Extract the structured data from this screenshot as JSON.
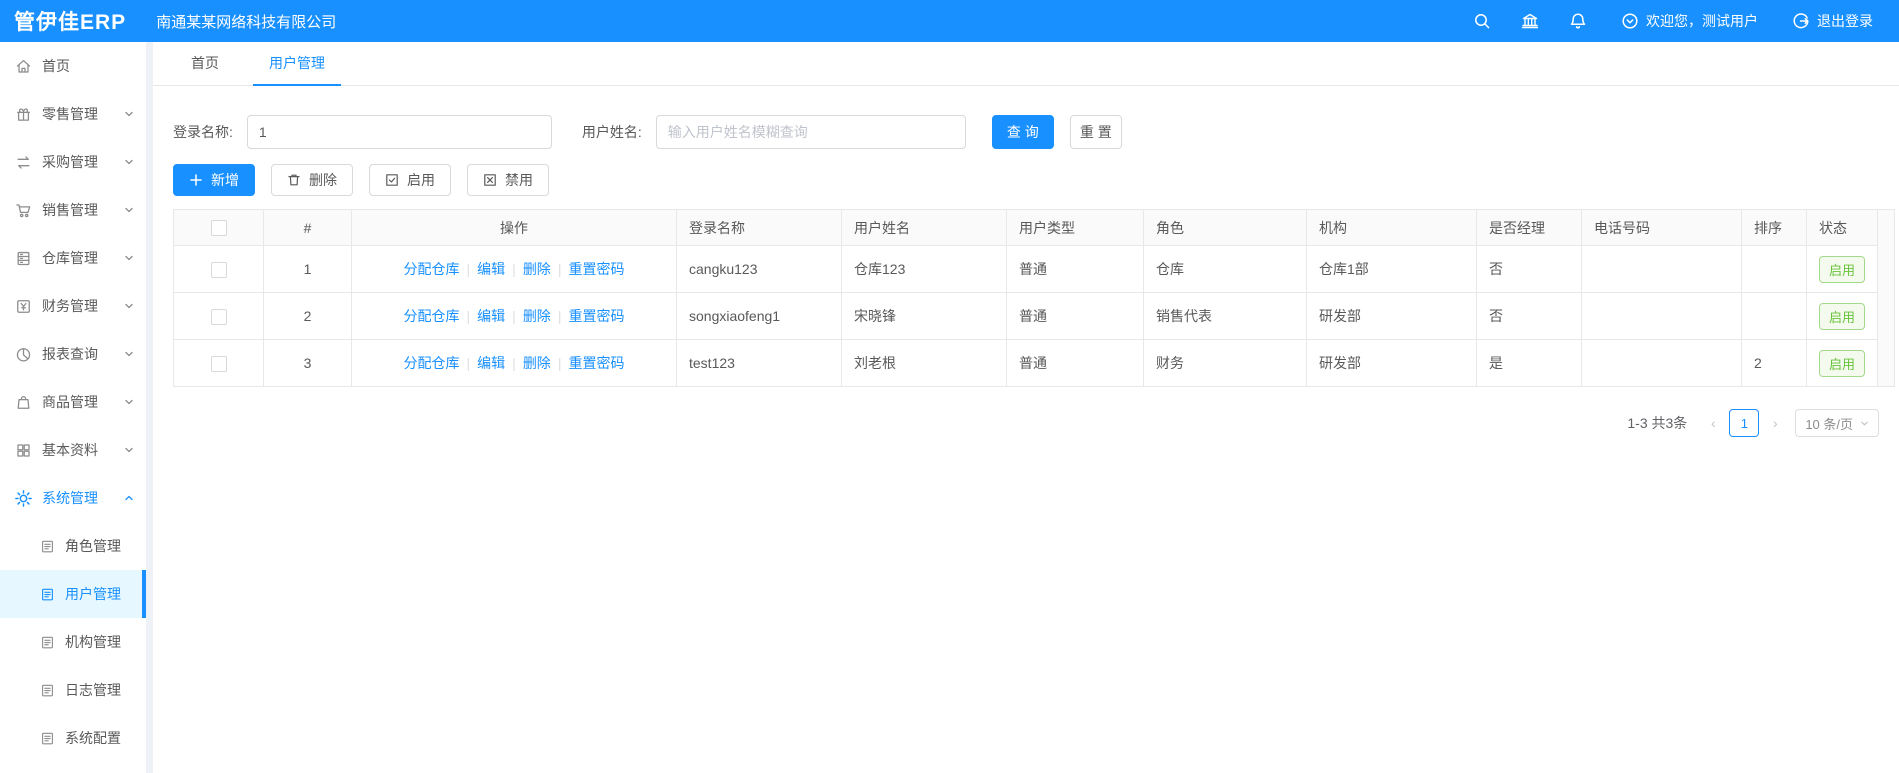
{
  "header": {
    "logo": "管伊佳ERP",
    "company": "南通某某网络科技有限公司",
    "welcome": "欢迎您，测试用户",
    "logout": "退出登录"
  },
  "sidebar": {
    "items": [
      {
        "label": "首页",
        "icon": "home-icon"
      },
      {
        "label": "零售管理",
        "icon": "gift-icon"
      },
      {
        "label": "采购管理",
        "icon": "swap-icon"
      },
      {
        "label": "销售管理",
        "icon": "cart-icon"
      },
      {
        "label": "仓库管理",
        "icon": "warehouse-icon"
      },
      {
        "label": "财务管理",
        "icon": "finance-icon"
      },
      {
        "label": "报表查询",
        "icon": "pie-icon"
      },
      {
        "label": "商品管理",
        "icon": "bag-icon"
      },
      {
        "label": "基本资料",
        "icon": "grid-icon"
      },
      {
        "label": "系统管理",
        "icon": "gear-icon",
        "active": true
      }
    ],
    "subitems": [
      {
        "label": "角色管理"
      },
      {
        "label": "用户管理",
        "selected": true
      },
      {
        "label": "机构管理"
      },
      {
        "label": "日志管理"
      },
      {
        "label": "系统配置"
      }
    ]
  },
  "tabs": {
    "home": "首页",
    "current": "用户管理"
  },
  "filter": {
    "login_label": "登录名称:",
    "login_value": "1",
    "name_label": "用户姓名:",
    "name_placeholder": "输入用户姓名模糊查询",
    "search": "查 询",
    "reset": "重 置"
  },
  "toolbar": {
    "add": "新增",
    "delete": "删除",
    "enable": "启用",
    "disable": "禁用"
  },
  "table": {
    "columns": {
      "index": "#",
      "ops": "操作",
      "login": "登录名称",
      "name": "用户姓名",
      "type": "用户类型",
      "role": "角色",
      "org": "机构",
      "manager": "是否经理",
      "phone": "电话号码",
      "sort": "排序",
      "status": "状态"
    },
    "ops": {
      "assign": "分配仓库",
      "edit": "编辑",
      "delete": "删除",
      "reset_pwd": "重置密码"
    },
    "rows": [
      {
        "index": "1",
        "login": "cangku123",
        "name": "仓库123",
        "type": "普通",
        "role": "仓库",
        "org": "仓库1部",
        "manager": "否",
        "phone": "",
        "sort": "",
        "status": "启用"
      },
      {
        "index": "2",
        "login": "songxiaofeng1",
        "name": "宋晓锋",
        "type": "普通",
        "role": "销售代表",
        "org": "研发部",
        "manager": "否",
        "phone": "",
        "sort": "",
        "status": "启用"
      },
      {
        "index": "3",
        "login": "test123",
        "name": "刘老根",
        "type": "普通",
        "role": "财务",
        "org": "研发部",
        "manager": "是",
        "phone": "",
        "sort": "2",
        "status": "启用"
      }
    ]
  },
  "pagination": {
    "total": "1-3 共3条",
    "prev": "‹",
    "page": "1",
    "next": "›",
    "page_size": "10 条/页"
  },
  "colors": {
    "primary": "#1890ff",
    "status_green": "#67c23a",
    "selected_bg": "#e6f7ff"
  }
}
